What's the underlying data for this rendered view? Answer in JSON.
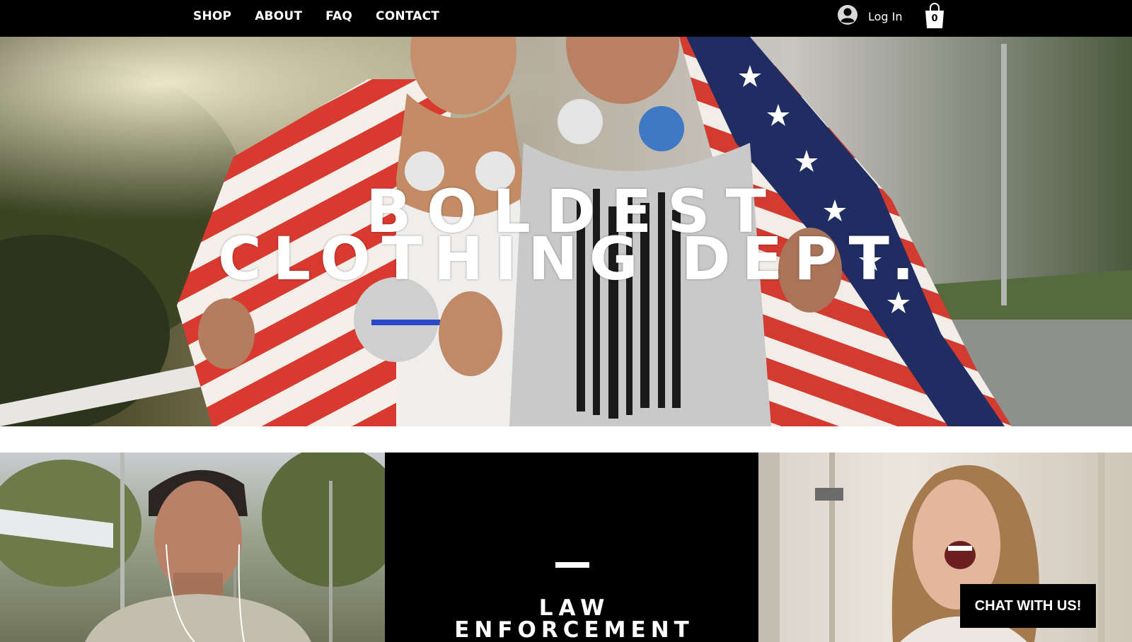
{
  "nav": {
    "items": [
      {
        "label": "SHOP"
      },
      {
        "label": "ABOUT"
      },
      {
        "label": "FAQ"
      },
      {
        "label": "CONTACT"
      }
    ],
    "login_label": "Log In",
    "login_icon": "user-avatar-icon",
    "cart_icon": "shopping-bag-icon",
    "cart_count": "0"
  },
  "hero": {
    "title_line1": "BOLDEST",
    "title_line2": "CLOTHING DEPT."
  },
  "categories": {
    "middle_title_line1": "LAW",
    "middle_title_line2": "ENFORCEMENT"
  },
  "chat": {
    "label": "CHAT WITH US!"
  },
  "colors": {
    "nav_bg": "#000000",
    "text": "#ffffff",
    "panel_dark": "#000000"
  }
}
